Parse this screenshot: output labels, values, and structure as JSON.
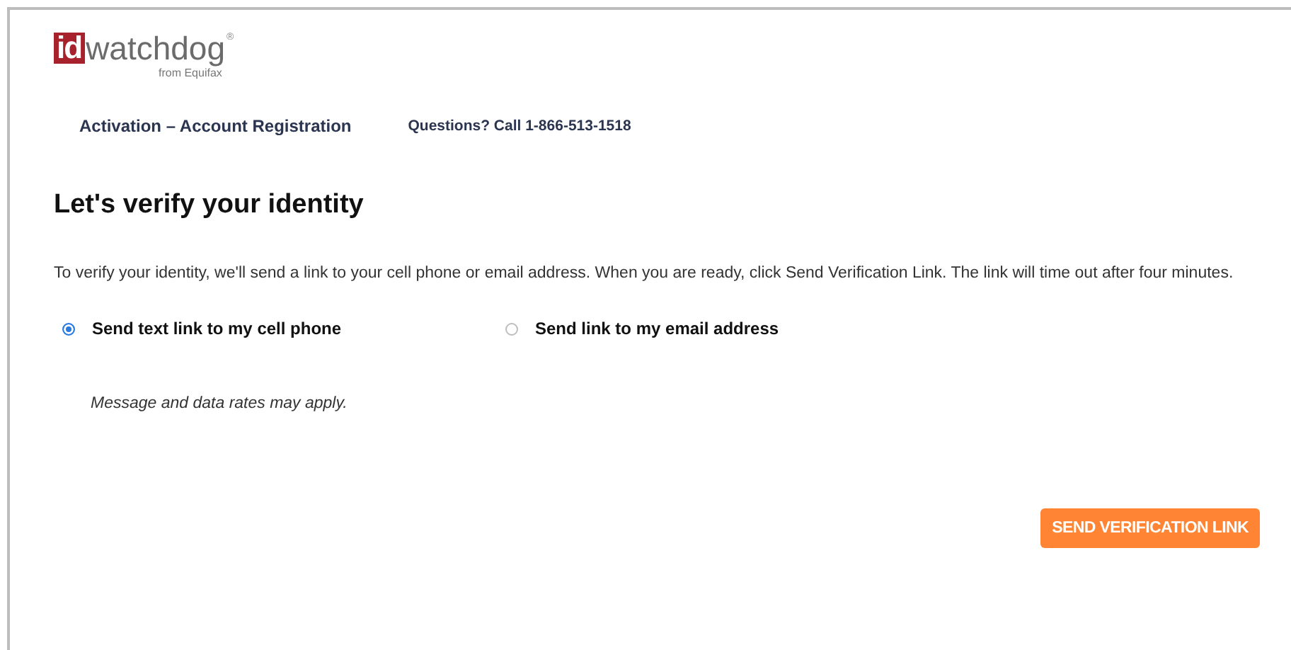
{
  "logo": {
    "prefix": "id",
    "name": "watchdog",
    "mark": "®",
    "tagline": "from Equifax"
  },
  "nav": [
    {
      "label": "Activation – Account Registration"
    },
    {
      "label": "Questions? Call 1-866-513-1518"
    }
  ],
  "heading": "Let's verify your identity",
  "intro": "To verify your identity, we'll send a link to your cell phone or email address. When you are ready, click Send Verification Link. The link will time out after four minutes.",
  "options": [
    {
      "label": "Send text link to my cell phone",
      "selected": true
    },
    {
      "label": "Send link to my email address",
      "selected": false
    }
  ],
  "note": "Message and data rates may apply.",
  "button": "SEND VERIFICATION LINK"
}
